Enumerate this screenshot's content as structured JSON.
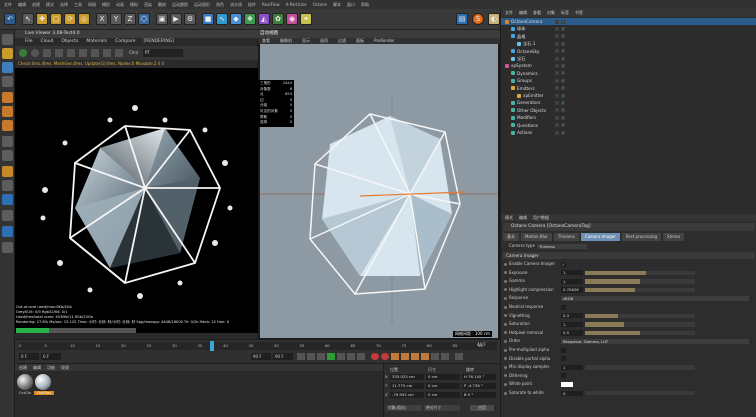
{
  "colors": {
    "accent": "#6d8fb5",
    "progress": "#27b24a",
    "selected": "#2b5c8a"
  },
  "menubar": [
    "文件",
    "编辑",
    "创建",
    "模式",
    "选择",
    "工具",
    "网格",
    "捕捉",
    "动画",
    "模拟",
    "渲染",
    "雕刻",
    "运动跟踪",
    "运动图形",
    "角色",
    "流水线",
    "插件",
    "RealFlow",
    "X-Particles",
    "Octane",
    "脚本",
    "窗口",
    "帮助"
  ],
  "toolbar": {
    "axis_x": "X",
    "axis_y": "Y",
    "axis_z": "Z"
  },
  "live_viewer": {
    "title": "Live Viewer 3.08-Test4.0",
    "menus": [
      "File",
      "Cloud",
      "Objects",
      "Materials",
      "Compare",
      "[RENDERING]"
    ],
    "channel": "Chnl",
    "channel_value": "PT",
    "status": "Check:0ms./0ms. MeshGen:0ms. Update[G]:0ms. Nodes:0 Movable:2  0 0",
    "info_lines": [
      "Out-of-core used/max:0Kb/4Gb",
      "Grey8/16: 0/0      Rgb32/64: 0/1",
      "Used/free/total vram: 453Mb/11.9Gb/23Gb",
      "Rendering: 27.8%  Ms/sec: 23.125  Time: 小时: 分钟: 秒/小时: 分钟: 秒  Spp/maxspp: 4448/16000  Tri: 0/2k  Mesh: 22  Hair: 0"
    ],
    "progress": 0.278
  },
  "viewport": {
    "title": "自动视图",
    "menus": [
      "查看",
      "摄像机",
      "显示",
      "选项",
      "过滤",
      "面板",
      "ProRender"
    ],
    "stats": [
      [
        "三角形",
        "2444"
      ],
      [
        "对象数",
        "6"
      ],
      [
        "点",
        "653"
      ],
      [
        "边",
        "0"
      ],
      [
        "分组",
        "0"
      ],
      [
        "可见的对象",
        "0"
      ],
      [
        "帮助",
        "0"
      ],
      [
        "选择",
        "0"
      ]
    ],
    "grid_label": "网格间距 : 100 cm"
  },
  "object_manager": {
    "menus": [
      "文件",
      "编辑",
      "查看",
      "对象",
      "标签",
      "书签"
    ],
    "rows": [
      {
        "name": "OctaneCamera",
        "indent": 0,
        "selected": true
      },
      {
        "name": "球体",
        "indent": 1,
        "selected": false
      },
      {
        "name": "晶格",
        "indent": 1,
        "selected": false
      },
      {
        "name": "宝石.1",
        "indent": 2,
        "selected": false
      },
      {
        "name": "OctaneSky",
        "indent": 1,
        "selected": false
      },
      {
        "name": "宝石",
        "indent": 1,
        "selected": false
      },
      {
        "name": "xpSystem",
        "indent": 0,
        "selected": false
      },
      {
        "name": "Dynamics",
        "indent": 1,
        "selected": false
      },
      {
        "name": "Groups",
        "indent": 1,
        "selected": false
      },
      {
        "name": "Emitters",
        "indent": 1,
        "selected": false
      },
      {
        "name": "xpEmitter",
        "indent": 2,
        "selected": false
      },
      {
        "name": "Generators",
        "indent": 1,
        "selected": false
      },
      {
        "name": "Other Objects",
        "indent": 1,
        "selected": false
      },
      {
        "name": "Modifiers",
        "indent": 1,
        "selected": false
      },
      {
        "name": "Questions",
        "indent": 1,
        "selected": false
      },
      {
        "name": "Actions",
        "indent": 1,
        "selected": false
      }
    ]
  },
  "attributes": {
    "menus": [
      "模式",
      "编辑",
      "用户数据"
    ],
    "header": "Octane Camera [OctaneCameraTag]",
    "tabs": [
      {
        "label": "基本",
        "active": false
      },
      {
        "label": "Motion Blur",
        "active": false
      },
      {
        "label": "Thinlens",
        "active": false
      },
      {
        "label": "Camera Imager",
        "active": true
      },
      {
        "label": "Post processing",
        "active": false
      },
      {
        "label": "Stereo",
        "active": false
      }
    ],
    "camera_type_label": "Camera type",
    "camera_type_value": "Thinlens",
    "section": "Camera Imager",
    "rows": [
      {
        "label": "Enable Camera Imager",
        "kind": "check",
        "value": "✓"
      },
      {
        "label": "Exposure",
        "kind": "slider",
        "value": "1.",
        "fill": 0.55
      },
      {
        "label": "Gamma",
        "kind": "slider",
        "value": "1.",
        "fill": 0.5
      },
      {
        "label": "Highlight compression",
        "kind": "slider",
        "value": "0.70626",
        "fill": 0.45
      },
      {
        "label": "Response",
        "kind": "dropdown",
        "value": "sRGB"
      },
      {
        "label": "Neutral response",
        "kind": "check",
        "value": ""
      },
      {
        "label": "Vignetting",
        "kind": "slider",
        "value": "0.3",
        "fill": 0.3
      },
      {
        "label": "Saturation",
        "kind": "slider",
        "value": "1.",
        "fill": 0.35
      },
      {
        "label": "Hotpixel removal",
        "kind": "slider",
        "value": "0.5",
        "fill": 0.5
      },
      {
        "label": "Order",
        "kind": "dropdown",
        "value": "Response, Gamma, LUT"
      },
      {
        "label": "Pre-multiplied alpha",
        "kind": "check",
        "value": ""
      },
      {
        "label": "Disable partial alpha",
        "kind": "check",
        "value": ""
      },
      {
        "label": "Min display samples",
        "kind": "slider",
        "value": "1",
        "fill": 0.0
      },
      {
        "label": "Dithering",
        "kind": "check",
        "value": ""
      },
      {
        "label": "White point",
        "kind": "swatch",
        "value": ""
      },
      {
        "label": "Saturate to white",
        "kind": "slider",
        "value": "0.",
        "fill": 0.0
      }
    ]
  },
  "timeline": {
    "ticks": [
      "0",
      "5",
      "10",
      "15",
      "20",
      "25",
      "30",
      "35",
      "40",
      "45",
      "50",
      "55",
      "60",
      "65",
      "70",
      "75",
      "80",
      "85",
      "90"
    ],
    "current_frame": "0 F",
    "start": "0 F",
    "end": "90 F",
    "end2": "90 F",
    "frame_badge": "44 F"
  },
  "materials": {
    "menus": [
      "创建",
      "编辑",
      "功能",
      "纹理"
    ],
    "items": [
      "OctGlo",
      "OctGlas"
    ]
  },
  "coordinates": {
    "headers": [
      "位置",
      "尺寸",
      "旋转"
    ],
    "rows": [
      {
        "axis": "X",
        "pos": "335.023 cm",
        "size": "0 cm",
        "rot": "H  76.145 °"
      },
      {
        "axis": "Y",
        "pos": "11.775 cm",
        "size": "0 cm",
        "rot": "P  -4.736 °"
      },
      {
        "axis": "Z",
        "pos": "-79.952 cm",
        "size": "0 cm",
        "rot": "B  0 °"
      }
    ],
    "mode": "对象(相对)",
    "mode2": "绝对尺寸",
    "apply": "应用"
  }
}
